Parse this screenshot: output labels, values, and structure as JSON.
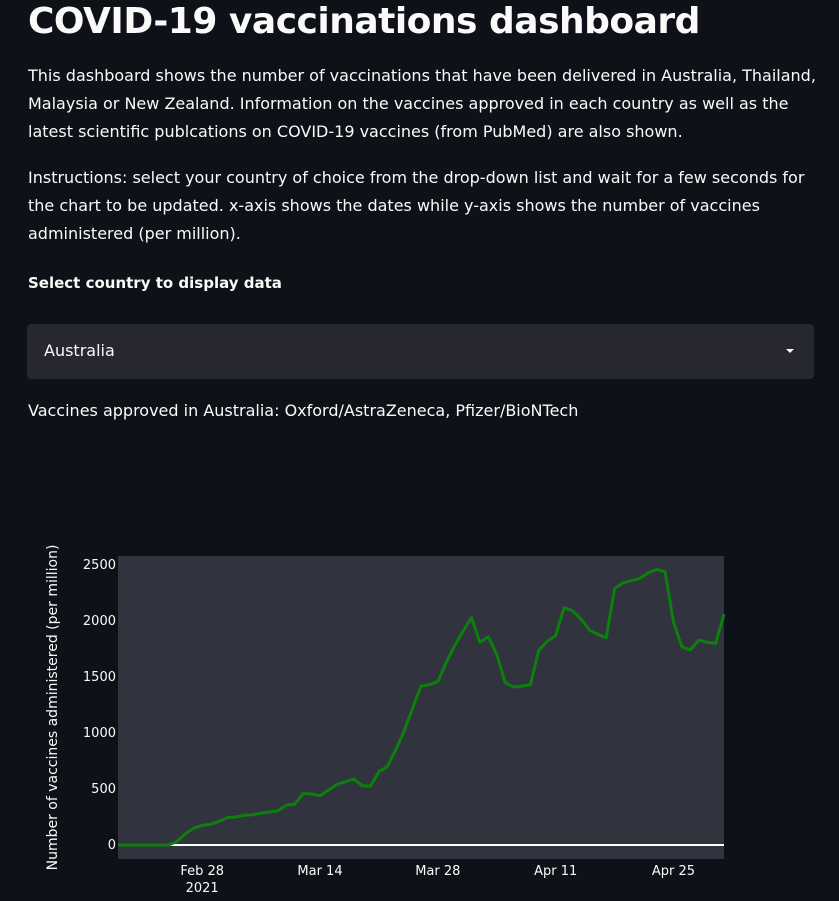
{
  "page": {
    "title": "COVID-19 vaccinations dashboard",
    "description": "This dashboard shows the number of vaccinations that have been delivered in Australia, Thailand, Malaysia or New Zealand. Information on the vaccines approved in each country as well as the latest scientific publcations on COVID-19 vaccines (from PubMed) are also shown.",
    "instructions": "Instructions: select your country of choice from the drop-down list and wait for a few seconds for the chart to be updated. x-axis shows the dates while y-axis shows the number of vaccines administered (per million)."
  },
  "country_select": {
    "label": "Select country to display data",
    "selected": "Australia"
  },
  "approved": {
    "prefix": "Vaccines approved in Australia: ",
    "vaccines": "Oxford/AstraZeneca, Pfizer/BioNTech"
  },
  "colors": {
    "background": "#0e1117",
    "plot_background": "#31333f",
    "line": "#0c7f0c",
    "zero_line": "#ffffff"
  },
  "chart_data": {
    "type": "line",
    "ylabel": "Number of vaccines administered (per million)",
    "xlabel": "",
    "ylim": [
      0,
      2600
    ],
    "y_ticks": [
      "0",
      "500",
      "1000",
      "1500",
      "2000",
      "2500"
    ],
    "x_ticks": [
      "Feb 28",
      "Mar 14",
      "Mar 28",
      "Apr 11",
      "Apr 25"
    ],
    "x_tick_sub": "2021",
    "x_range": [
      "2021-02-18",
      "2021-05-01"
    ],
    "grid": false,
    "series": [
      {
        "x": [
          "2021-02-18",
          "2021-02-19",
          "2021-02-20",
          "2021-02-21",
          "2021-02-22",
          "2021-02-23",
          "2021-02-24",
          "2021-02-25",
          "2021-02-26",
          "2021-02-27",
          "2021-02-28",
          "2021-03-01",
          "2021-03-02",
          "2021-03-03",
          "2021-03-04",
          "2021-03-05",
          "2021-03-06",
          "2021-03-07",
          "2021-03-08",
          "2021-03-09",
          "2021-03-10",
          "2021-03-11",
          "2021-03-12",
          "2021-03-13",
          "2021-03-14",
          "2021-03-15",
          "2021-03-16",
          "2021-03-17",
          "2021-03-18",
          "2021-03-19",
          "2021-03-20",
          "2021-03-21",
          "2021-03-22",
          "2021-03-23",
          "2021-03-24",
          "2021-03-25",
          "2021-03-26",
          "2021-03-27",
          "2021-03-28",
          "2021-03-29",
          "2021-03-30",
          "2021-03-31",
          "2021-04-01",
          "2021-04-02",
          "2021-04-03",
          "2021-04-04",
          "2021-04-05",
          "2021-04-06",
          "2021-04-07",
          "2021-04-08",
          "2021-04-09",
          "2021-04-10",
          "2021-04-11",
          "2021-04-12",
          "2021-04-13",
          "2021-04-14",
          "2021-04-15",
          "2021-04-16",
          "2021-04-17",
          "2021-04-18",
          "2021-04-19",
          "2021-04-20",
          "2021-04-21",
          "2021-04-22",
          "2021-04-23",
          "2021-04-24",
          "2021-04-25",
          "2021-04-26",
          "2021-04-27",
          "2021-04-28",
          "2021-04-29",
          "2021-04-30",
          "2021-05-01"
        ],
        "y": [
          0,
          0,
          0,
          0,
          0,
          0,
          0,
          30,
          100,
          150,
          175,
          185,
          210,
          245,
          250,
          265,
          270,
          285,
          295,
          305,
          355,
          365,
          460,
          455,
          440,
          490,
          540,
          565,
          590,
          530,
          525,
          655,
          700,
          850,
          1020,
          1220,
          1420,
          1430,
          1460,
          1630,
          1780,
          1910,
          2030,
          1810,
          1860,
          1700,
          1450,
          1410,
          1420,
          1430,
          1740,
          1820,
          1870,
          2120,
          2090,
          2020,
          1920,
          1880,
          1850,
          2290,
          2340,
          2360,
          2380,
          2430,
          2460,
          2440,
          1990,
          1770,
          1740,
          1830,
          1810,
          1800,
          2060
        ]
      }
    ]
  }
}
